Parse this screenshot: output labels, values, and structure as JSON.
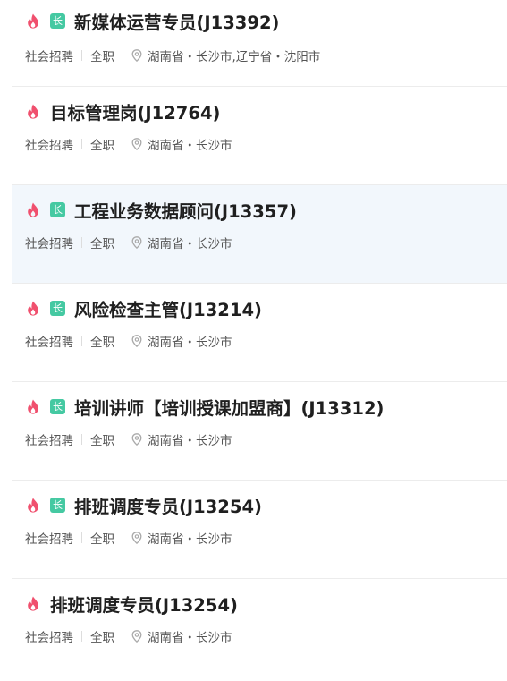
{
  "jobs": [
    {
      "title": "新媒体运营专员(J13392)",
      "badge": "长",
      "type": "社会招聘",
      "employment": "全职",
      "location": "湖南省・长沙市,辽宁省・沈阳市"
    },
    {
      "title": "目标管理岗(J12764)",
      "badge": "",
      "type": "社会招聘",
      "employment": "全职",
      "location": "湖南省・长沙市"
    },
    {
      "title": "工程业务数据顾问(J13357)",
      "badge": "长",
      "type": "社会招聘",
      "employment": "全职",
      "location": "湖南省・长沙市"
    },
    {
      "title": "风险检查主管(J13214)",
      "badge": "长",
      "type": "社会招聘",
      "employment": "全职",
      "location": "湖南省・长沙市"
    },
    {
      "title": "培训讲师【培训授课加盟商】(J13312)",
      "badge": "长",
      "type": "社会招聘",
      "employment": "全职",
      "location": "湖南省・长沙市"
    },
    {
      "title": "排班调度专员(J13254)",
      "badge": "长",
      "type": "社会招聘",
      "employment": "全职",
      "location": "湖南省・长沙市"
    },
    {
      "title": "排班调度专员(J13254)",
      "badge": "",
      "type": "社会招聘",
      "employment": "全职",
      "location": "湖南省・长沙市"
    }
  ],
  "icons": {
    "hot": "fire-icon",
    "location": "location-pin-icon"
  },
  "colors": {
    "fire": "#f0506e",
    "badge": "#45c9a2",
    "highlight": "#f2f7fc"
  }
}
